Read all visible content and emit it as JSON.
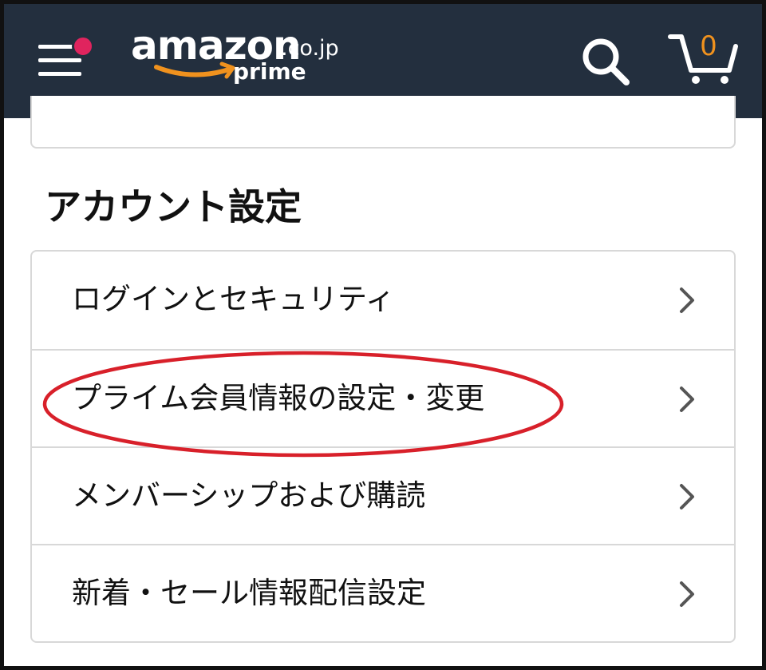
{
  "header": {
    "logo_word": "amazon",
    "logo_tld": ".co.jp",
    "logo_sub": "prime",
    "cart_count": "0",
    "bg_color": "#232f3e",
    "menu_badge_color": "#e0245e",
    "cart_count_color": "#f0921e",
    "icons": [
      "hamburger-menu-icon",
      "search-icon",
      "cart-icon"
    ]
  },
  "account_settings": {
    "title": "アカウント設定",
    "items": [
      {
        "label": "ログインとセキュリティ"
      },
      {
        "label": "プライム会員情報の設定・変更",
        "highlighted": true
      },
      {
        "label": "メンバーシップおよび購読"
      },
      {
        "label": "新着・セール情報配信設定"
      }
    ]
  },
  "annotation": {
    "color": "#d8202a",
    "target_item": "プライム会員情報の設定・変更"
  }
}
